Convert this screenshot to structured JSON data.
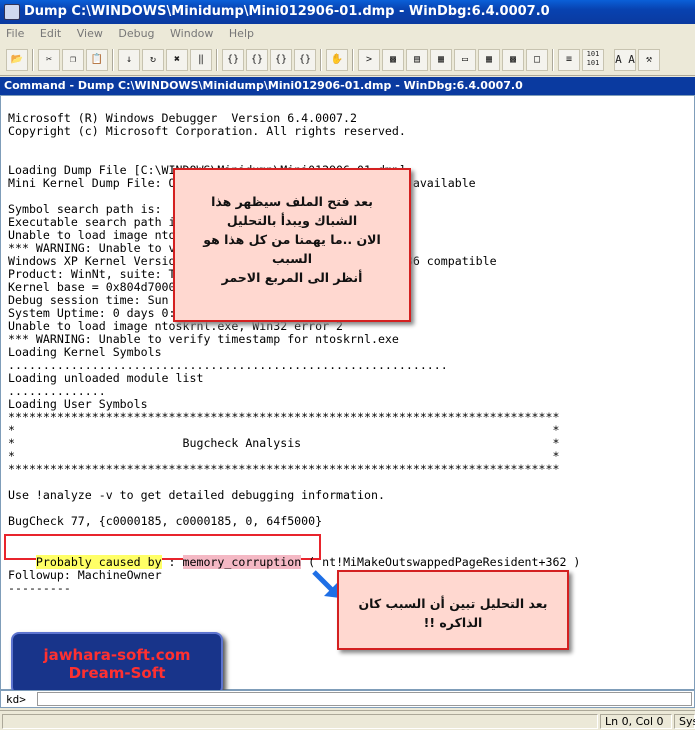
{
  "window": {
    "title": "Dump C:\\WINDOWS\\Minidump\\Mini012906-01.dmp - WinDbg:6.4.0007.0"
  },
  "menu": [
    "File",
    "Edit",
    "View",
    "Debug",
    "Window",
    "Help"
  ],
  "toolbar": {
    "binary_label": "101\n101",
    "font_label": "A A"
  },
  "command_window": {
    "title": "Command - Dump C:\\WINDOWS\\Minidump\\Mini012906-01.dmp - WinDbg:6.4.0007.0",
    "lines": [
      "Microsoft (R) Windows Debugger  Version 6.4.0007.2",
      "Copyright (c) Microsoft Corporation. All rights reserved.",
      "",
      "",
      "Loading Dump File [C:\\WINDOWS\\Minidump\\Mini012906-01.dmp]",
      "Mini Kernel Dump File: Only registers and stack trace are available",
      "",
      "Symbol search path is:",
      "Executable search path is:",
      "Unable to load image ntoskrnl.exe, Win32 error 2",
      "*** WARNING: Unable to verify timestamp for ntoskrnl.exe",
      "Windows XP Kernel Version 2600 (Service Pack 2) UP Free x86 compatible",
      "Product: WinNt, suite: TerminalServer SingleUserTS",
      "Kernel base = 0x804d7000 PsLoadedModuleList = 0x80555ab20",
      "Debug session time: Sun Jan 29 00:00:00.000 2006 (GMT+2)",
      "System Uptime: 0 days 0:00:00.000",
      "Unable to load image ntoskrnl.exe, Win32 error 2",
      "*** WARNING: Unable to verify timestamp for ntoskrnl.exe",
      "Loading Kernel Symbols",
      "...............................................................",
      "Loading unloaded module list",
      "..............",
      "Loading User Symbols",
      "*******************************************************************************",
      "*                                                                             *",
      "*                        Bugcheck Analysis                                    *",
      "*                                                                             *",
      "*******************************************************************************",
      "",
      "Use !analyze -v to get detailed debugging information.",
      "",
      "BugCheck 77, {c0000185, c0000185, 0, 64f5000}",
      ""
    ],
    "probably_caused_by": "Probably caused by",
    "colon": " : ",
    "cause": "memory_corruption",
    "cause_detail": " ( nt!MiMakeOutswappedPageResident+362 )",
    "followup": "Followup: MachineOwner",
    "dashes": "---------"
  },
  "annotations": {
    "note1": [
      "بعد فتح الملف سيظهر هذا",
      "الشباك ويبدأ بالتحليل",
      "الان ..ما يهمنا من كل هذا هو",
      "السبب",
      "أنظر الى المربع الاحمر"
    ],
    "note2": [
      "بعد التحليل تبين أن السبب كان",
      "الذاكره !!"
    ],
    "logo_line1": "jawhara-soft.com",
    "logo_line2": "Dream-Soft"
  },
  "command_input": {
    "prompt": "kd>",
    "value": ""
  },
  "status": {
    "position": "Ln 0, Col 0",
    "sys": "Sys"
  }
}
